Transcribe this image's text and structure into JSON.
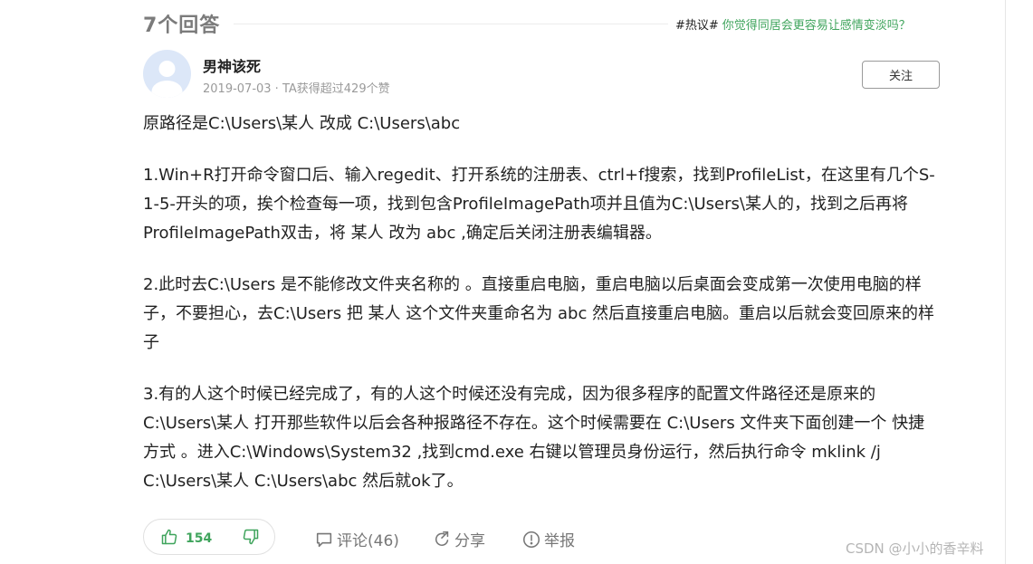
{
  "header": {
    "answers_count": "7个回答",
    "hot_tag": "#热议#",
    "hot_question": "你觉得同居会更容易让感情变淡吗？"
  },
  "author": {
    "name": "男神该死",
    "meta": "2019-07-03 · TA获得超过429个赞",
    "follow_label": "关注"
  },
  "answer": {
    "paragraphs": [
      "原路径是C:\\Users\\某人 改成 C:\\Users\\abc",
      "1.Win+R打开命令窗口后、输入regedit、打开系统的注册表、ctrl+f搜索，找到ProfileList，在这里有几个S-1-5-开头的项，挨个检查每一项，找到包含ProfileImagePath项并且值为C:\\Users\\某人的，找到之后再将ProfileImagePath双击，将 某人 改为 abc ,确定后关闭注册表编辑器。",
      "2.此时去C:\\Users 是不能修改文件夹名称的 。直接重启电脑，重启电脑以后桌面会变成第一次使用电脑的样子，不要担心，去C:\\Users 把 某人 这个文件夹重命名为 abc 然后直接重启电脑。重启以后就会变回原来的样子",
      "3.有的人这个时候已经完成了，有的人这个时候还没有完成，因为很多程序的配置文件路径还是原来的 C:\\Users\\某人 打开那些软件以后会各种报路径不存在。这个时候需要在 C:\\Users 文件夹下面创建一个 快捷方式 。进入C:\\Windows\\System32 ,找到cmd.exe 右键以管理员身份运行，然后执行命令 mklink /j C:\\Users\\某人 C:\\Users\\abc 然后就ok了。"
    ]
  },
  "actions": {
    "upvote_count": "154",
    "comment_label": "评论(46)",
    "share_label": "分享",
    "report_label": "举报"
  },
  "watermark": "CSDN @小小的香辛料",
  "icons": {
    "upvote": "thumbs-up-icon",
    "downvote": "thumbs-down-icon",
    "comment": "comment-icon",
    "share": "share-icon",
    "report": "report-icon"
  },
  "colors": {
    "accent_green": "#3fa45c",
    "muted_text": "#9a9a9a",
    "heading_gray": "#7b7b7b"
  }
}
